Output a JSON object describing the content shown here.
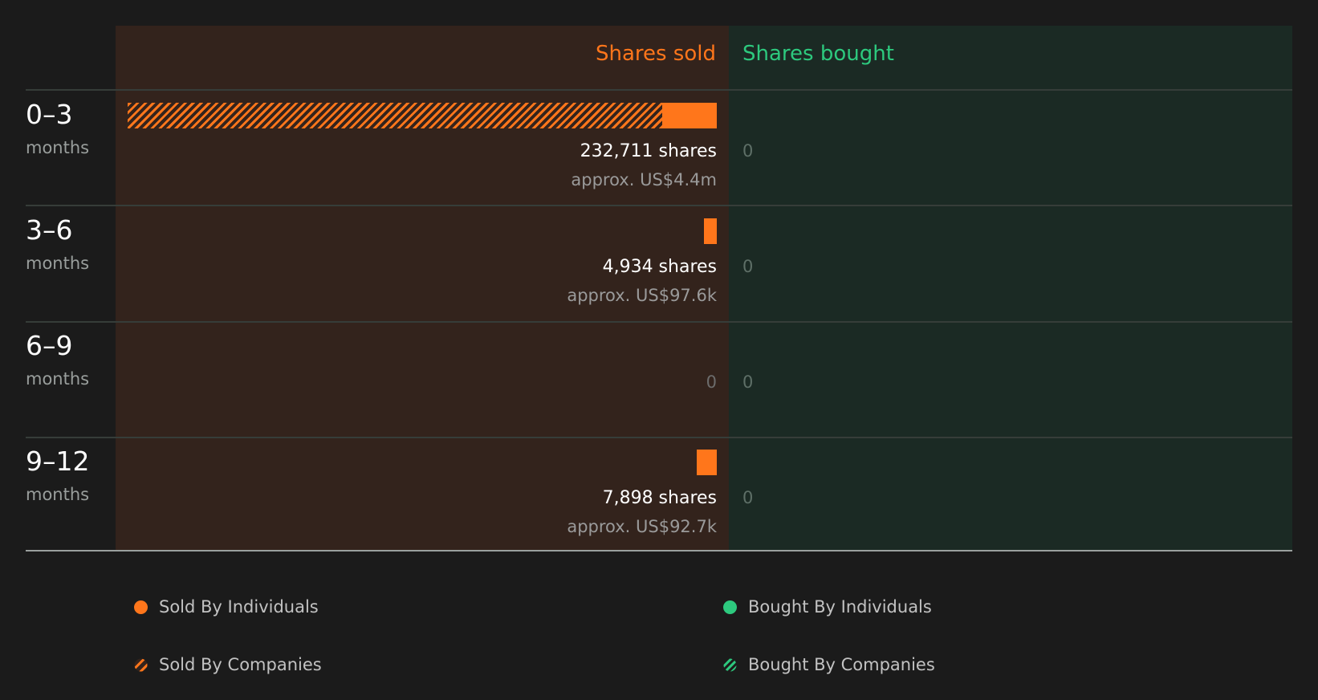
{
  "colors": {
    "sold": "#ff761b",
    "bought": "#2dc97e",
    "sold_panel": "#33231c",
    "bought_panel": "#1b2a24"
  },
  "header": {
    "sold_label": "Shares sold",
    "bought_label": "Shares bought"
  },
  "chart_data": {
    "type": "bar",
    "orientation": "horizontal-diverging",
    "categories": [
      "0–3 months",
      "3–6 months",
      "6–9 months",
      "9–12 months"
    ],
    "series": [
      {
        "name": "Sold By Individuals",
        "values": [
          21500,
          4934,
          0,
          7898
        ]
      },
      {
        "name": "Sold By Companies",
        "values": [
          211211,
          0,
          0,
          0
        ]
      },
      {
        "name": "Bought By Individuals",
        "values": [
          0,
          0,
          0,
          0
        ]
      },
      {
        "name": "Bought By Companies",
        "values": [
          0,
          0,
          0,
          0
        ]
      }
    ],
    "sold_max": 232711,
    "rows": [
      {
        "period": "0–3",
        "unit": "months",
        "sold_total": 232711,
        "sold_individuals": 21500,
        "sold_companies": 211211,
        "shares_label": "232,711 shares",
        "approx_label": "approx. US$4.4m",
        "bought_label": "0"
      },
      {
        "period": "3–6",
        "unit": "months",
        "sold_total": 4934,
        "sold_individuals": 4934,
        "sold_companies": 0,
        "shares_label": "4,934 shares",
        "approx_label": "approx. US$97.6k",
        "bought_label": "0"
      },
      {
        "period": "6–9",
        "unit": "months",
        "sold_total": 0,
        "sold_individuals": 0,
        "sold_companies": 0,
        "shares_label": "0",
        "approx_label": "",
        "bought_label": "0"
      },
      {
        "period": "9–12",
        "unit": "months",
        "sold_total": 7898,
        "sold_individuals": 7898,
        "sold_companies": 0,
        "shares_label": "7,898 shares",
        "approx_label": "approx. US$92.7k",
        "bought_label": "0"
      }
    ]
  },
  "legend": {
    "sold_individuals": "Sold By Individuals",
    "sold_companies": "Sold By Companies",
    "bought_individuals": "Bought By Individuals",
    "bought_companies": "Bought By Companies"
  }
}
